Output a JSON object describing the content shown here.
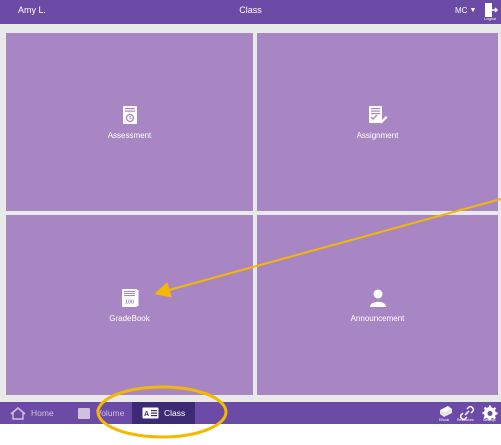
{
  "header": {
    "user_name": "Amy L.",
    "title": "Class",
    "course": "MC",
    "logout_label": "Logout"
  },
  "tiles": [
    {
      "label": "Assessment",
      "icon": "assessment-icon"
    },
    {
      "label": "Assignment",
      "icon": "assignment-icon"
    },
    {
      "label": "GradeBook",
      "icon": "gradebook-icon"
    },
    {
      "label": "Announcement",
      "icon": "announcement-icon"
    }
  ],
  "nav": {
    "home": "Home",
    "volume": "Volume",
    "class": "Class"
  },
  "utilities": {
    "ebook": "EBook",
    "resources": "Resources",
    "settings": "Settings"
  },
  "colors": {
    "bar": "#6b4ba6",
    "tile": "#a886c4",
    "active_nav": "#3d2a75",
    "annotation": "#f5b800"
  }
}
